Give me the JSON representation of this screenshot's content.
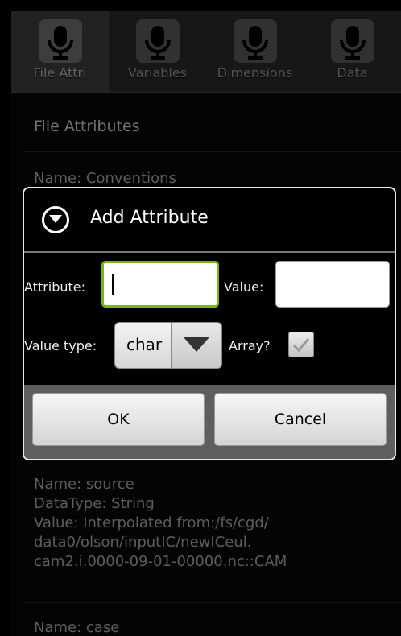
{
  "tabs": [
    {
      "label": "File Attri",
      "icon": "microphone-icon",
      "selected": true
    },
    {
      "label": "Variables",
      "icon": "microphone-icon",
      "selected": false
    },
    {
      "label": "Dimensions",
      "icon": "microphone-icon",
      "selected": false
    },
    {
      "label": "Data",
      "icon": "microphone-icon",
      "selected": false
    }
  ],
  "list": {
    "title": "File Attributes",
    "items": [
      {
        "lines": [
          "Name: Conventions"
        ]
      },
      {
        "lines": [
          "Name: source",
          "DataType: String",
          "Value: Interpolated from:/fs/cgd/",
          "data0/olson/inputIC/newICeul.",
          "cam2.i.0000-09-01-00000.nc::CAM"
        ]
      },
      {
        "lines": [
          "Name: case"
        ]
      }
    ]
  },
  "dialog": {
    "title": "Add Attribute",
    "attribute_label": "Attribute:",
    "attribute_value": "",
    "value_label": "Value:",
    "value_value": "",
    "value_type_label": "Value type:",
    "value_type_selected": "char",
    "array_label": "Array?",
    "array_checked": true,
    "ok_label": "OK",
    "cancel_label": "Cancel"
  },
  "colors": {
    "focus_accent": "#7ab51c",
    "background": "#080808"
  }
}
